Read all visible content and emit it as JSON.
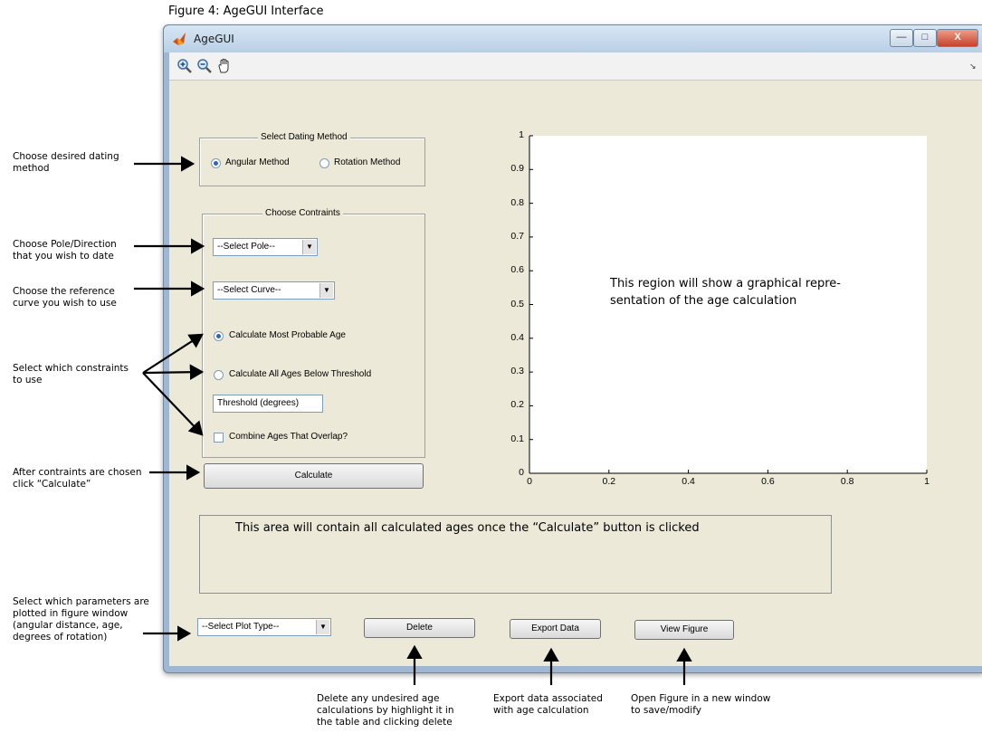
{
  "figure_caption": "Figure 4: AgeGUI Interface",
  "window": {
    "title": "AgeGUI",
    "controls": {
      "minimize": "—",
      "maximize": "□",
      "close": "X"
    }
  },
  "toolbar": {
    "tools": [
      {
        "name": "zoom-in-icon"
      },
      {
        "name": "zoom-out-icon"
      },
      {
        "name": "pan-hand-icon"
      }
    ],
    "overflow_arrow": "↘"
  },
  "dating_method": {
    "title": "Select Dating Method",
    "options": [
      {
        "label": "Angular Method",
        "selected": true
      },
      {
        "label": "Rotation Method",
        "selected": false
      }
    ]
  },
  "constraints": {
    "title": "Choose Contraints",
    "pole_select": "--Select Pole--",
    "curve_select": "--Select Curve--",
    "most_probable_label": "Calculate Most Probable Age",
    "most_probable_selected": true,
    "all_ages_label": "Calculate All Ages Below Threshold",
    "all_ages_selected": false,
    "threshold_field": "Threshold (degrees)",
    "combine_label": "Combine Ages That Overlap?",
    "combine_checked": false
  },
  "calculate_button": "Calculate",
  "plot": {
    "y_ticks": [
      "0",
      "0.1",
      "0.2",
      "0.3",
      "0.4",
      "0.5",
      "0.6",
      "0.7",
      "0.8",
      "0.9",
      "1"
    ],
    "x_ticks": [
      "0",
      "0.2",
      "0.4",
      "0.6",
      "0.8",
      "1"
    ],
    "overlay_line1": "This region will show a graphical repre-",
    "overlay_line2": "sentation of the age calculation"
  },
  "results_area": "This area will contain all calculated ages once the “Calculate” button is clicked",
  "bottom": {
    "plot_type_select": "--Select Plot Type--",
    "delete_button": "Delete",
    "export_button": "Export Data",
    "view_button": "View Figure"
  },
  "annotations": {
    "dating": [
      "Choose desired dating",
      "method"
    ],
    "pole": [
      "Choose Pole/Direction",
      "that you wish to date"
    ],
    "curve": [
      "Choose the reference",
      " curve you wish to use"
    ],
    "constraints": [
      "Select which constraints",
      "to use"
    ],
    "calculate": [
      "After contraints are chosen",
      "click “Calculate”"
    ],
    "plot_type": [
      "Select which parameters are",
      "plotted in figure window",
      "(angular distance,  age,",
      "degrees of rotation)"
    ],
    "delete": [
      "Delete any undesired age",
      "calculations by highlight it in",
      "the table and clicking delete"
    ],
    "export": [
      "Export data associated",
      "with age calculation"
    ],
    "view": [
      "Open Figure in a new window",
      "to save/modify"
    ]
  },
  "colors": {
    "window_frame": "#9fb7d0",
    "client_bg": "#ece9d8",
    "radio_dot": "#2d66c0",
    "arrows": "#000000"
  }
}
